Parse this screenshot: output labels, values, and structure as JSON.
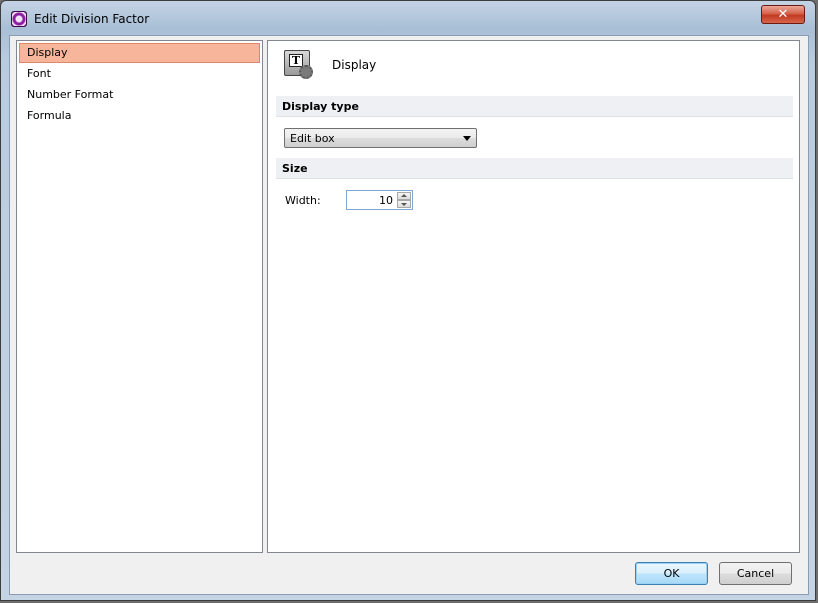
{
  "window": {
    "title": "Edit Division Factor",
    "close_glyph": "✕"
  },
  "nav": {
    "items": [
      {
        "label": "Display",
        "selected": true
      },
      {
        "label": "Font",
        "selected": false
      },
      {
        "label": "Number Format",
        "selected": false
      },
      {
        "label": "Formula",
        "selected": false
      }
    ]
  },
  "panel": {
    "title": "Display",
    "icon_letter": "T",
    "display_type": {
      "header": "Display type",
      "selected": "Edit box"
    },
    "size": {
      "header": "Size",
      "width_label": "Width:",
      "width_value": "10"
    }
  },
  "buttons": {
    "ok": "OK",
    "cancel": "Cancel"
  },
  "colors": {
    "selection": "#f7b69b",
    "default_button": "#bee6fd",
    "close_button": "#c23a22"
  }
}
